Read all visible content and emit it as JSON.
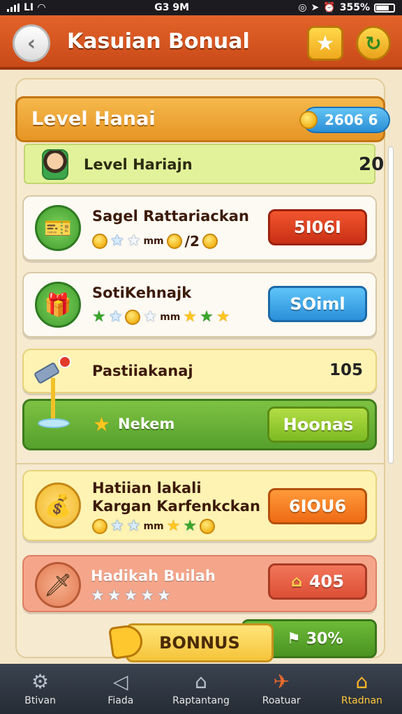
{
  "status_bar": {
    "carrier": "LI",
    "time": "G3 9M",
    "battery": "355%"
  },
  "header": {
    "title": "Kasuian Bonual"
  },
  "level_banner": {
    "title": "Level Hanai",
    "coins": "2606 6"
  },
  "level_row": {
    "label": "Level Hariajn",
    "value": "20"
  },
  "rewards": [
    {
      "title": "Sagel Rattariackan",
      "reward_text": "mm",
      "reward_count": "/2",
      "button": "5I06I",
      "button_color": "#d93a1a"
    },
    {
      "title": "SotiKehnajk",
      "reward_text": "mm",
      "button": "SOiml",
      "button_color": "#2b8fda"
    },
    {
      "title": "Pastiiakanaj",
      "value": "105",
      "bar_label": "Nekem",
      "button": "Hoonas",
      "button_color": "#7dba22"
    },
    {
      "title_line1": "Hatiian lakali",
      "title_line2": "Kargan Karfenkckan",
      "reward_text": "mm",
      "button": "6IOU6",
      "button_color": "#ee6a14"
    },
    {
      "title": "Hadikah Builah",
      "button": "405",
      "button_color": "#dc4f36"
    }
  ],
  "bonus": {
    "label": "BONNUS",
    "percent": "30%"
  },
  "bottom_nav": [
    {
      "label": "Btivan",
      "icon": "gear-icon"
    },
    {
      "label": "Fiada",
      "icon": "send-icon"
    },
    {
      "label": "Raptantang",
      "icon": "home-icon"
    },
    {
      "label": "Roatuar",
      "icon": "map-icon"
    },
    {
      "label": "Rtadnan",
      "icon": "shop-icon",
      "active": true
    }
  ],
  "colors": {
    "header": "#d9561f",
    "banner": "#eea432",
    "accent_gold": "#ffc72e"
  }
}
